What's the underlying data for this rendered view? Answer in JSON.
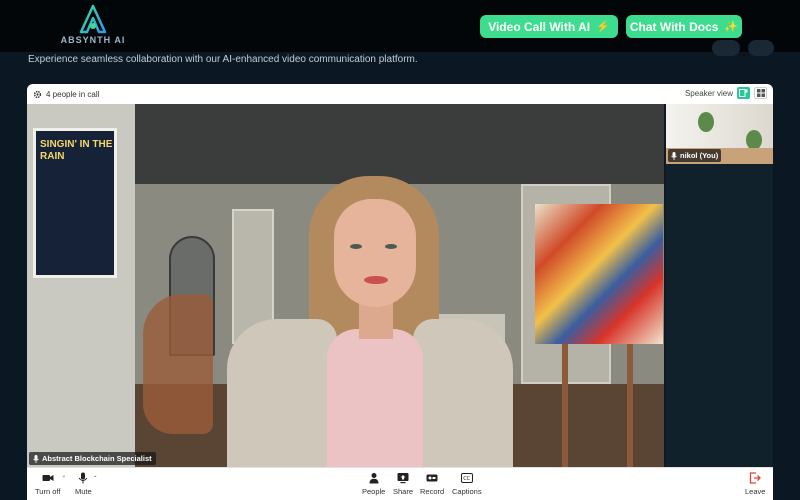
{
  "nav": {
    "logo_text": "ABSYNTH AI",
    "video_button": "Video Call With AI",
    "video_glyph": "⚡",
    "docs_button": "Chat With Docs",
    "docs_glyph": "✨"
  },
  "hero": {
    "subtitle": "Experience seamless collaboration with our AI-enhanced video communication platform."
  },
  "call": {
    "people_count": "4 people in call",
    "view_label": "Speaker view",
    "main_participant": "Abstract Blockchain Specialist",
    "self_participant": "nikol (You)",
    "poster_text": "SINGIN' IN THE RAIN"
  },
  "controls": {
    "camera": "Turn off",
    "mute": "Mute",
    "people": "People",
    "share": "Share",
    "record": "Record",
    "captions": "Captions",
    "leave": "Leave"
  },
  "colors": {
    "accent": "#3ddc8e",
    "view_active": "#27c79a",
    "leave": "#e0443a",
    "background": "#0b1824"
  }
}
